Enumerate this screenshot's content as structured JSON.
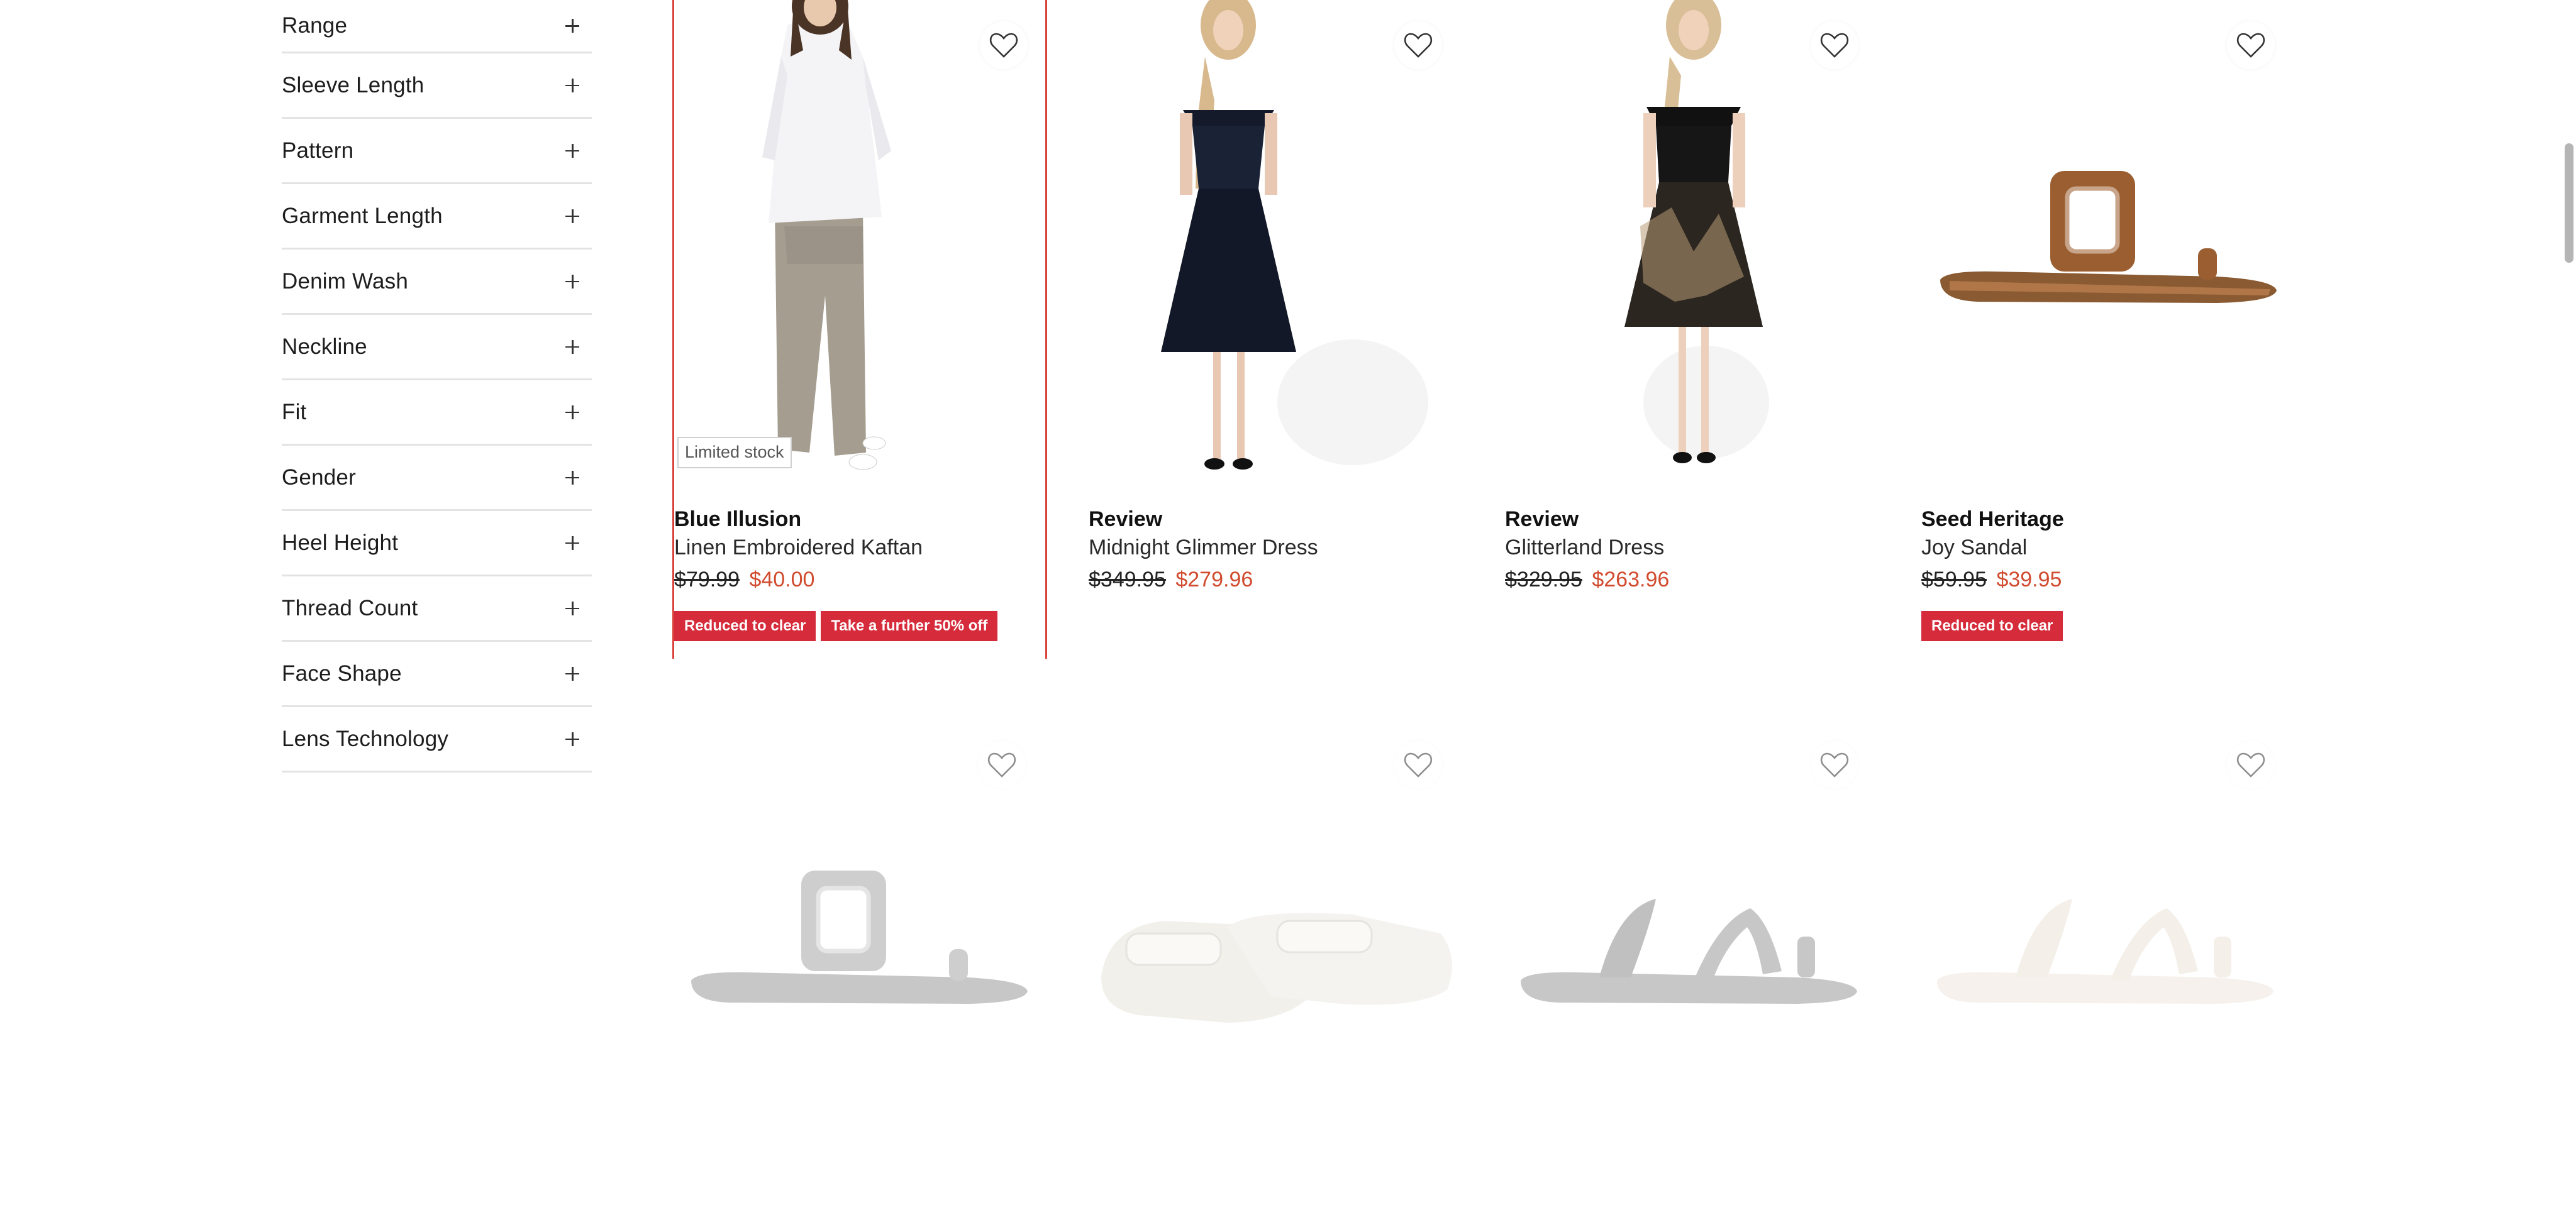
{
  "filters": [
    {
      "label": "Range"
    },
    {
      "label": "Sleeve Length"
    },
    {
      "label": "Pattern"
    },
    {
      "label": "Garment Length"
    },
    {
      "label": "Denim Wash"
    },
    {
      "label": "Neckline"
    },
    {
      "label": "Fit"
    },
    {
      "label": "Gender"
    },
    {
      "label": "Heel Height"
    },
    {
      "label": "Thread Count"
    },
    {
      "label": "Face Shape"
    },
    {
      "label": "Lens Technology"
    }
  ],
  "products": [
    {
      "brand": "Blue Illusion",
      "name": "Linen Embroidered Kaftan",
      "price_was": "$79.99",
      "price_now": "$40.00",
      "stock_badge": "Limited stock",
      "promos": [
        "Reduced to clear",
        "Take a further 50% off"
      ]
    },
    {
      "brand": "Review",
      "name": "Midnight Glimmer Dress",
      "price_was": "$349.95",
      "price_now": "$279.96",
      "promos": []
    },
    {
      "brand": "Review",
      "name": "Glitterland Dress",
      "price_was": "$329.95",
      "price_now": "$263.96",
      "promos": []
    },
    {
      "brand": "Seed Heritage",
      "name": "Joy Sandal",
      "price_was": "$59.95",
      "price_now": "$39.95",
      "promos": [
        "Reduced to clear"
      ]
    }
  ],
  "colors": {
    "promo_bg": "#d62b3a",
    "sale_price": "#d14b2e",
    "selected_border": "#d9413a"
  }
}
